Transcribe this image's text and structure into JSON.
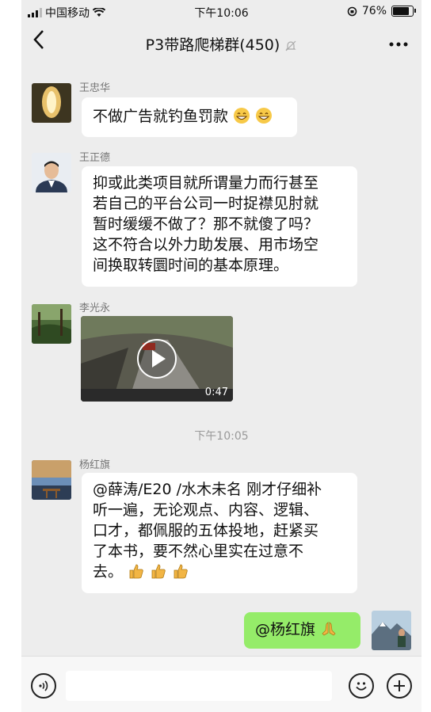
{
  "status_bar": {
    "carrier": "中国移动",
    "time": "下午10:06",
    "battery": "76%"
  },
  "nav": {
    "title": "P3带路爬梯群(450)",
    "back_icon": "chevron-left-icon",
    "more_icon": "ellipsis-icon",
    "mute_icon": "bell-off-icon"
  },
  "messages": [
    {
      "sender": "王忠华",
      "text": "不做广告就钓鱼罚款"
    },
    {
      "sender": "王正德",
      "lines": [
        "抑或此类项目就所谓量力而行甚至",
        "若自己的平台公司一时捉襟见肘就",
        "暂时缓缓不做了？那不就傻了吗？",
        "这不符合以外力助发展、用市场空",
        "间换取转圜时间的基本原理。"
      ]
    },
    {
      "sender": "李光永",
      "video_duration": "0:47"
    },
    {
      "sender": "杨红旗",
      "lines": [
        "@薛涛/E20 /水木未名 刚才仔细补",
        "听一遍，无论观点、内容、逻辑、",
        "口才，都佩服的五体投地，赶紧买",
        "了本书，要不然心里实在过意不",
        "去。"
      ]
    }
  ],
  "timestamp": "下午10:05",
  "my_message": {
    "text": "@杨红旗"
  },
  "input_bar": {
    "voice_icon": "voice-icon",
    "emoji_icon": "emoji-icon",
    "plus_icon": "plus-icon"
  }
}
